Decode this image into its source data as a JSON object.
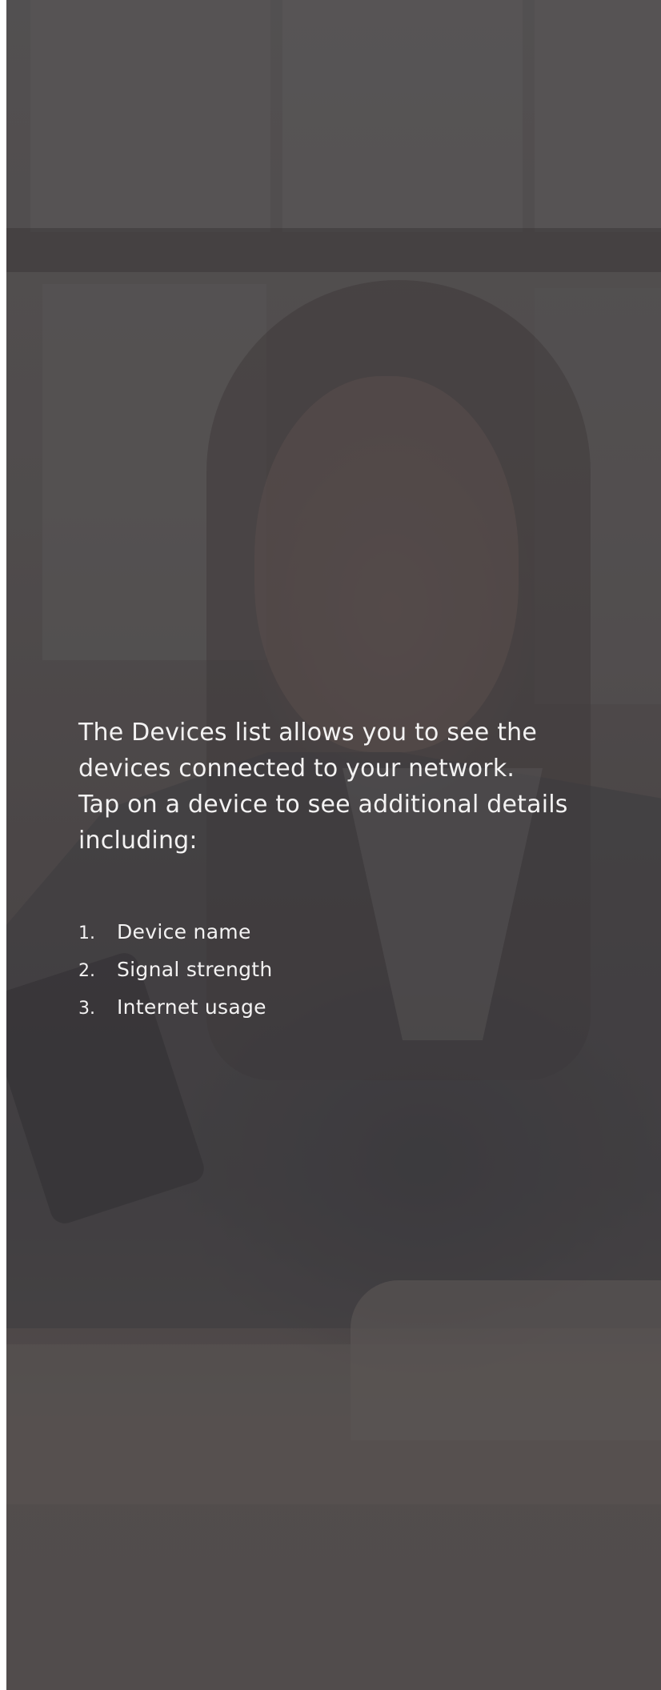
{
  "intro": {
    "line1": "The Devices list allows you to see the",
    "line2": "devices connected to your network.",
    "line3": "Tap on a device to see additional details",
    "line4": "including:"
  },
  "details": [
    {
      "number": "1.",
      "label": "Device name"
    },
    {
      "number": "2.",
      "label": "Signal strength"
    },
    {
      "number": "3.",
      "label": "Internet usage"
    }
  ],
  "background": {
    "overlay_color": "#3c3a3c"
  }
}
